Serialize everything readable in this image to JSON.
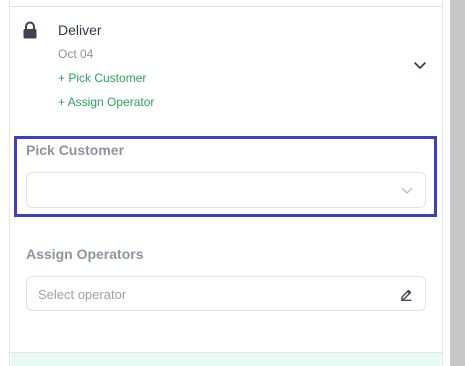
{
  "stop": {
    "title": "Deliver",
    "date": "Oct 04",
    "pick_customer_link": "+ Pick Customer",
    "assign_operator_link": "+ Assign Operator",
    "status_icon": "lock-icon",
    "expand_icon": "chevron-down-icon"
  },
  "pick_customer": {
    "label": "Pick Customer",
    "value": "",
    "dropdown_icon": "chevron-down-icon"
  },
  "assign_operators": {
    "label": "Assign Operators",
    "placeholder": "Select operator",
    "edit_icon": "pencil-icon"
  },
  "colors": {
    "link_green": "#28a55f",
    "highlight_border": "#3b3fc4",
    "label_gray": "#8d959e",
    "footer_mint": "#e8faf4",
    "scrollbar_gray": "#c7c7c7"
  }
}
